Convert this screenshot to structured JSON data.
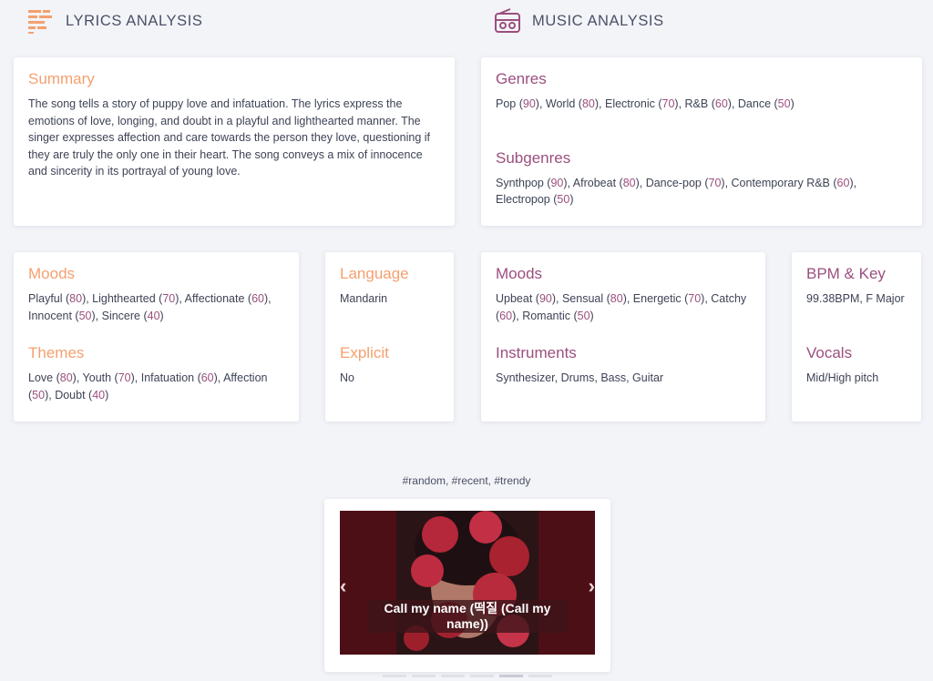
{
  "lyrics_header": {
    "title": "LYRICS ANALYSIS",
    "icon": "lines-icon"
  },
  "music_header": {
    "title": "MUSIC ANALYSIS",
    "icon": "radio-icon"
  },
  "summary": {
    "heading": "Summary",
    "text": "The song tells a story of puppy love and infatuation. The lyrics express the emotions of love, longing, and doubt in a playful and lighthearted manner. The singer expresses affection and care towards the person they love, questioning if they are truly the only one in their heart. The song conveys a mix of innocence and sincerity in its portrayal of young love."
  },
  "genres": {
    "heading": "Genres",
    "items": [
      {
        "name": "Pop",
        "score": "90"
      },
      {
        "name": "World",
        "score": "80"
      },
      {
        "name": "Electronic",
        "score": "70"
      },
      {
        "name": "R&B",
        "score": "60"
      },
      {
        "name": "Dance",
        "score": "50"
      }
    ]
  },
  "subgenres": {
    "heading": "Subgenres",
    "items": [
      {
        "name": "Synthpop",
        "score": "90"
      },
      {
        "name": "Afrobeat",
        "score": "80"
      },
      {
        "name": "Dance-pop",
        "score": "70"
      },
      {
        "name": "Contemporary R&B",
        "score": "60"
      },
      {
        "name": "Electropop",
        "score": "50"
      }
    ]
  },
  "lyrics_moods": {
    "heading": "Moods",
    "items": [
      {
        "name": "Playful",
        "score": "80"
      },
      {
        "name": "Lighthearted",
        "score": "70"
      },
      {
        "name": "Affectionate",
        "score": "60"
      },
      {
        "name": "Innocent",
        "score": "50"
      },
      {
        "name": "Sincere",
        "score": "40"
      }
    ]
  },
  "themes": {
    "heading": "Themes",
    "items": [
      {
        "name": "Love",
        "score": "80"
      },
      {
        "name": "Youth",
        "score": "70"
      },
      {
        "name": "Infatuation",
        "score": "60"
      },
      {
        "name": "Affection",
        "score": "50"
      },
      {
        "name": "Doubt",
        "score": "40"
      }
    ]
  },
  "language": {
    "heading": "Language",
    "value": "Mandarin"
  },
  "explicit": {
    "heading": "Explicit",
    "value": "No"
  },
  "music_moods": {
    "heading": "Moods",
    "items": [
      {
        "name": "Upbeat",
        "score": "90"
      },
      {
        "name": "Sensual",
        "score": "80"
      },
      {
        "name": "Energetic",
        "score": "70"
      },
      {
        "name": "Catchy",
        "score": "60"
      },
      {
        "name": "Romantic",
        "score": "50"
      }
    ]
  },
  "instruments": {
    "heading": "Instruments",
    "value": "Synthesizer, Drums, Bass, Guitar"
  },
  "bpm_key": {
    "heading": "BPM & Key",
    "value": "99.38BPM, F Major"
  },
  "vocals": {
    "heading": "Vocals",
    "value": "Mid/High pitch"
  },
  "tags": "#random, #recent, #trendy",
  "carousel": {
    "caption": "Call my name (떡질 (Call my name))",
    "prev": "‹",
    "next": "›",
    "slide_count": 6,
    "active_index": 4
  },
  "colors": {
    "orange": "#f4a06f",
    "purple": "#9b4f7e",
    "background": "#f3f4f8"
  }
}
